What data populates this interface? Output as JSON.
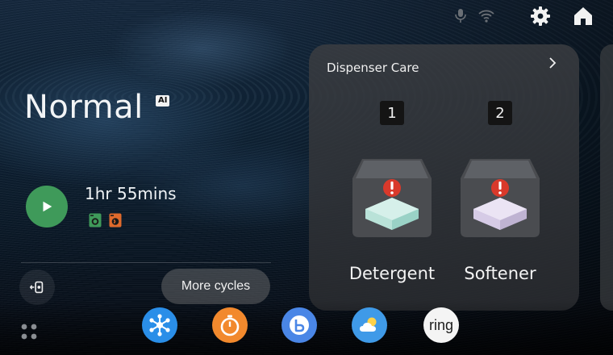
{
  "status": {
    "icons": [
      "mic-icon",
      "wifi-icon"
    ]
  },
  "top_buttons": {
    "settings": "gear-icon",
    "home": "home-icon"
  },
  "cycle": {
    "name": "Normal",
    "ai_badge": "AI",
    "duration": "1hr 55mins",
    "indicator_icons": [
      "washer-icon",
      "dryer-icon"
    ],
    "play_icon": "play-icon",
    "play_color": "#3f9a5a"
  },
  "actions": {
    "more_cycles_label": "More cycles",
    "left_icon": "exit-door-icon"
  },
  "dispenser_card": {
    "title": "Dispenser Care",
    "chevron": "chevron-right-icon",
    "slots": [
      {
        "number": "1",
        "label": "Detergent",
        "alert": true,
        "color": "#bfe6df"
      },
      {
        "number": "2",
        "label": "Softener",
        "alert": true,
        "color": "#ddd3ea"
      }
    ],
    "alert_color": "#d9392b"
  },
  "dock": {
    "grid_icon": "app-grid-icon",
    "apps": [
      {
        "name": "smartthings-icon",
        "color": "#2a8ee8"
      },
      {
        "name": "timer-icon",
        "color": "#f2892d"
      },
      {
        "name": "bixby-icon",
        "color": "#4a86e6"
      },
      {
        "name": "weather-icon",
        "color": "#3f9ae8"
      },
      {
        "name": "ring-app-icon",
        "label": "ring",
        "color": "#f4f4f4"
      }
    ]
  }
}
